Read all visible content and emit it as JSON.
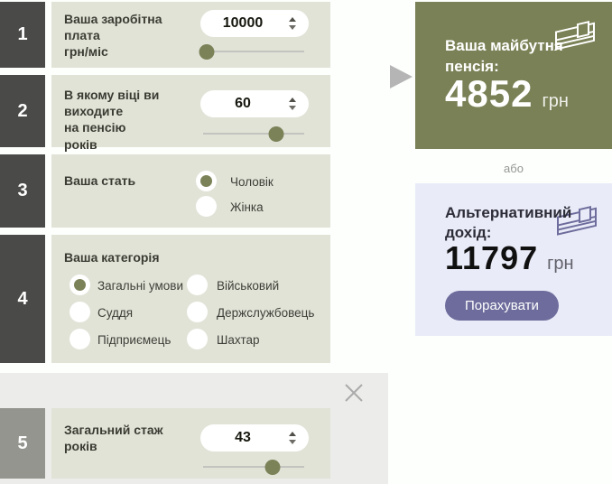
{
  "colors": {
    "accent_olive": "#7a8156",
    "panel_beige": "#e1e3d7",
    "number_box_dark": "#4a4a48",
    "number_box_gray": "#95958f",
    "section5_bg": "#ececea",
    "alt_panel_bg": "#e9ebf8",
    "button_purple": "#6d6c9c",
    "slider_thumb": "#7b8258"
  },
  "rows": [
    {
      "number": "1",
      "label": "Ваша заробітна плата\nгрн/міс",
      "value": "10000",
      "slider_left": "4%"
    },
    {
      "number": "2",
      "label": "В якому віці ви виходите\nна пенсію\nроків",
      "value": "60",
      "slider_left": "72%"
    },
    {
      "number": "3",
      "label": "Ваша стать",
      "options": [
        {
          "label": "Чоловік",
          "selected": true
        },
        {
          "label": "Жінка",
          "selected": false
        }
      ]
    },
    {
      "number": "4",
      "label": "Ваша категорія",
      "options": [
        {
          "label": "Загальні умови",
          "selected": true
        },
        {
          "label": "Військовий",
          "selected": false
        },
        {
          "label": "Суддя",
          "selected": false
        },
        {
          "label": "Держслужбовець",
          "selected": false
        },
        {
          "label": "Підприємець",
          "selected": false
        },
        {
          "label": "Шахтар",
          "selected": false
        }
      ]
    },
    {
      "number": "5",
      "label": "Загальний стаж\nроків",
      "value": "43",
      "slider_left": "69%"
    }
  ],
  "result_panel": {
    "title": "Ваша майбутня пенсія:",
    "value": "4852",
    "currency": "грн"
  },
  "separator_text": "або",
  "alt_panel": {
    "title": "Альтернативний дохід:",
    "value": "11797",
    "currency": "грн",
    "button_label": "Порахувати"
  }
}
